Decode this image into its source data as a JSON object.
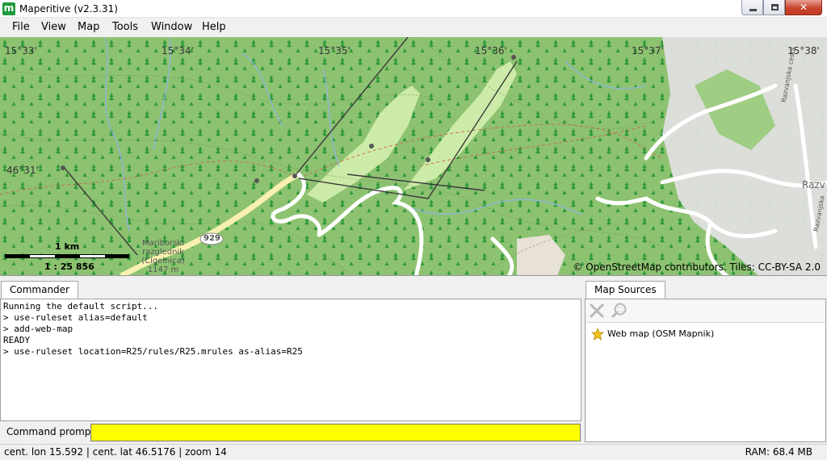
{
  "window": {
    "title": "Maperitive (v2.3.31)",
    "app_icon_letter": "m"
  },
  "menu": {
    "items": [
      "File",
      "View",
      "Map",
      "Tools",
      "Window",
      "Help"
    ]
  },
  "map": {
    "longitude_labels": [
      "15°33'",
      "15°34'",
      "15°35'",
      "15°36'",
      "15°37'",
      "15°38'"
    ],
    "latitude_labels": [
      "46°31'"
    ],
    "place_labels": {
      "viewpoint": [
        "Mariborski",
        "razglednik",
        "(Cigelnica)",
        "1147 m"
      ],
      "road_number": "929",
      "town_partial": "Razv",
      "street_1": "Razvanjska cesta",
      "street_2": "Razvanjska"
    },
    "scale": {
      "distance": "1 km",
      "ratio": "1 : 25 856"
    },
    "attribution": "© OpenStreetMap contributors. Tiles: CC-BY-SA 2.0",
    "colors": {
      "forest": "#8dc271",
      "meadow": "#cdeba8",
      "residential": "#e0dfdf",
      "road": "#ffffff",
      "major_road": "#f8f0b0"
    }
  },
  "commander": {
    "tab_label": "Commander",
    "lines": [
      "Running the default script...",
      "> use-ruleset alias=default",
      "> add-web-map",
      "READY",
      "> use-ruleset location=R25/rules/R25.mrules as-alias=R25"
    ],
    "prompt_label": "Command prompt:",
    "prompt_value": ""
  },
  "map_sources": {
    "tab_label": "Map Sources",
    "toolbar": {
      "remove_icon": "close-x-icon",
      "zoom_icon": "zoom-to-icon"
    },
    "items": [
      {
        "label": "Web map (OSM Mapnik)",
        "icon": "star-icon"
      }
    ]
  },
  "status": {
    "position": "cent. lon 15.592 | cent. lat 46.5176 | zoom 14",
    "ram": "RAM: 68.4 MB"
  }
}
